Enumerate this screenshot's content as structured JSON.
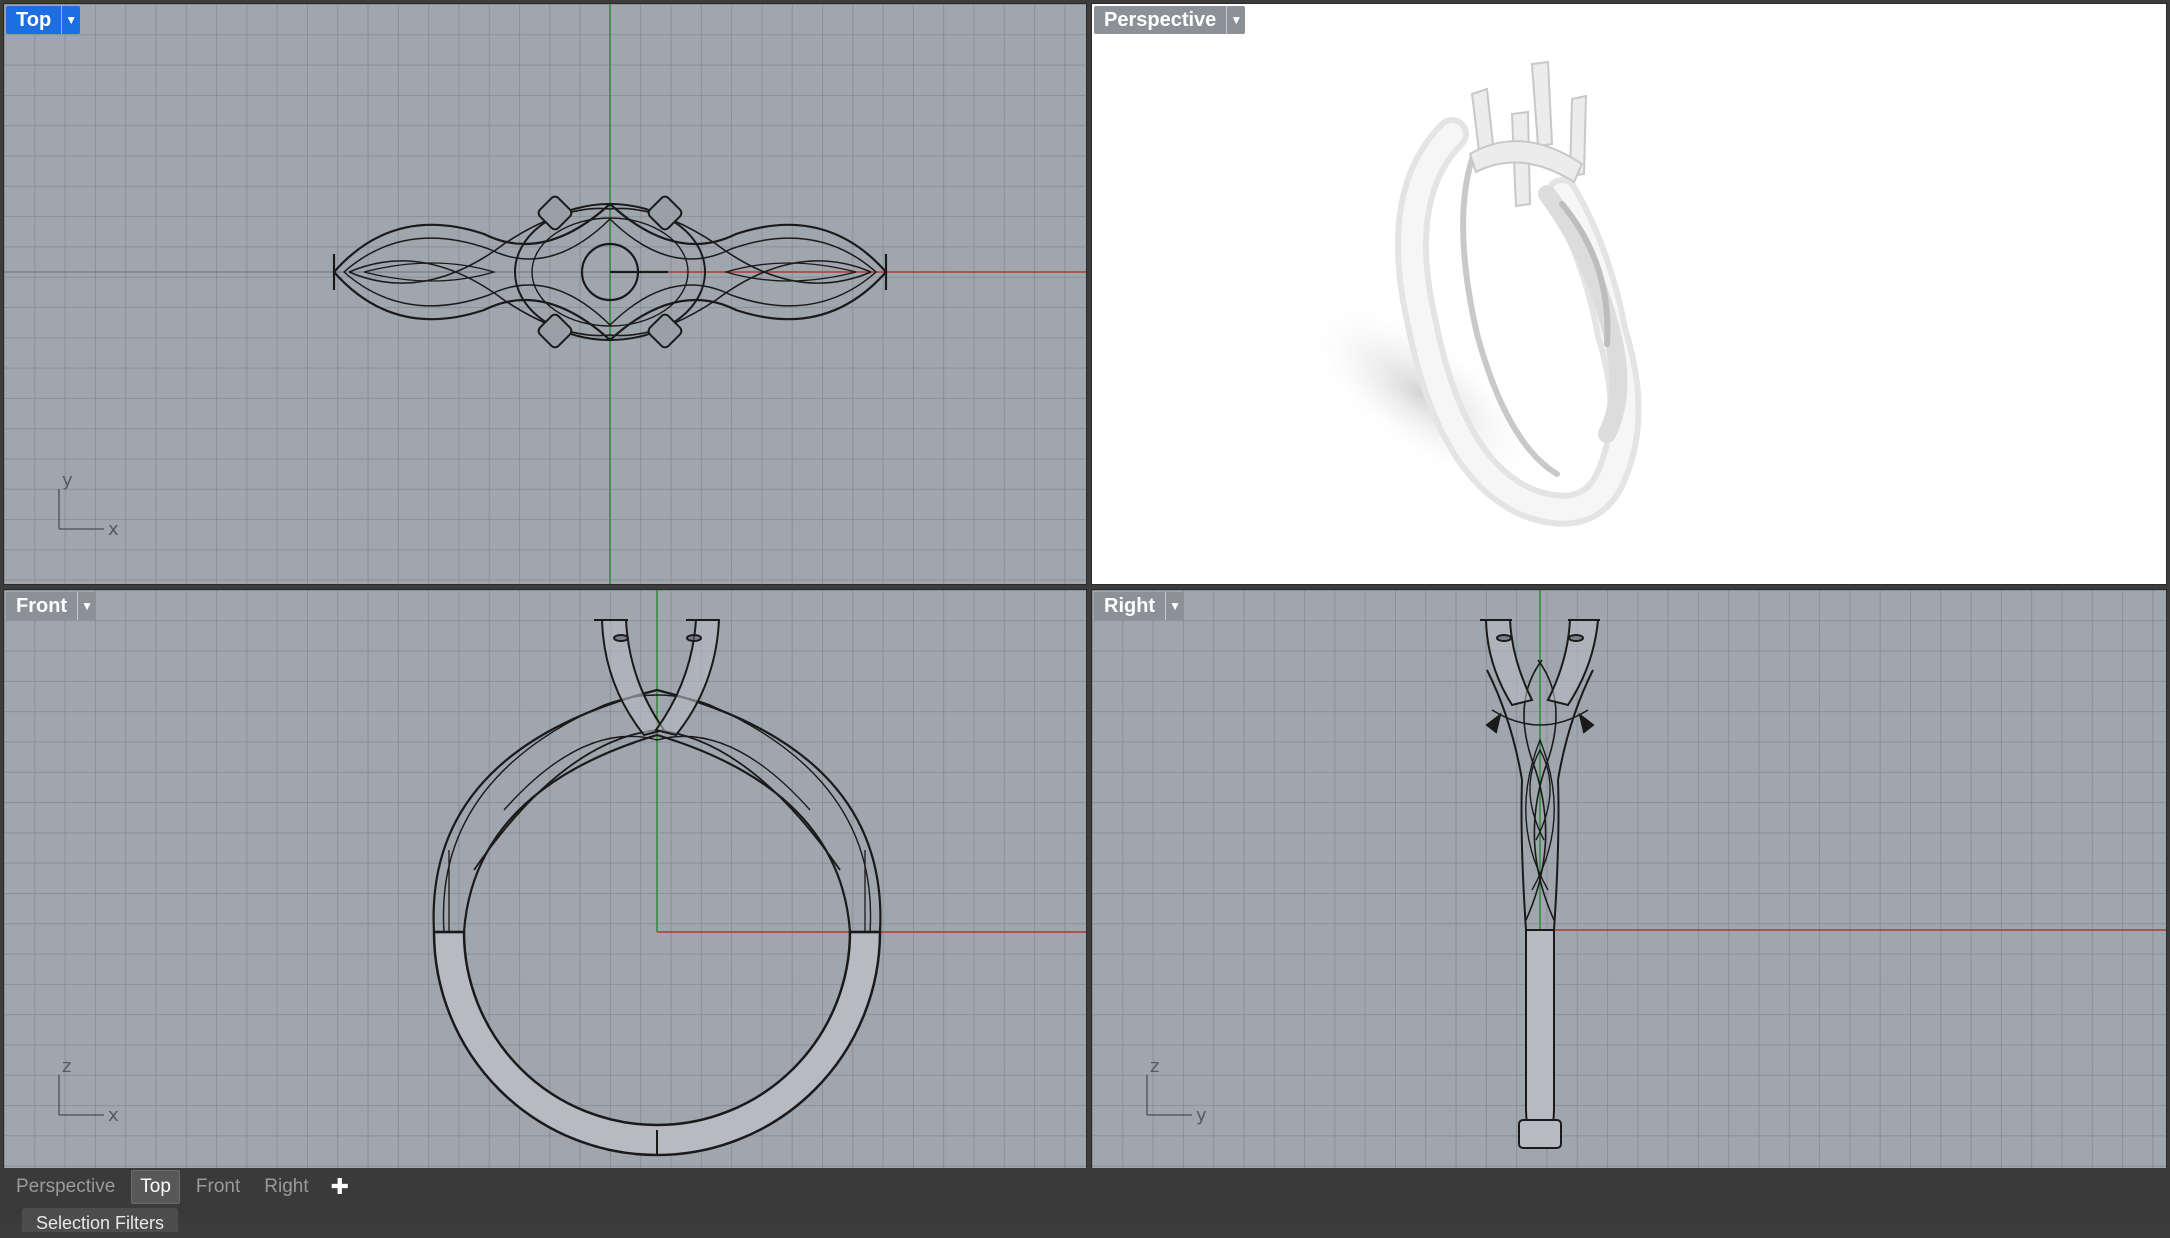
{
  "viewports": {
    "top": {
      "label": "Top",
      "active": true,
      "axis_labels": [
        "y",
        "x"
      ]
    },
    "perspective": {
      "label": "Perspective"
    },
    "front": {
      "label": "Front",
      "axis_labels": [
        "z",
        "x"
      ]
    },
    "right": {
      "label": "Right",
      "axis_labels": [
        "z",
        "y"
      ]
    }
  },
  "bottom_tabs": [
    {
      "label": "Perspective"
    },
    {
      "label": "Top",
      "active": true
    },
    {
      "label": "Front"
    },
    {
      "label": "Right"
    }
  ],
  "add_tab": "✚",
  "selection_filters": "Selection Filters",
  "colors": {
    "accent": "#1b6fe0",
    "viewport_bg": "#a0a6ae",
    "x_axis": "#b03a2e",
    "y_axis": "#2f8a3a"
  },
  "icons": {
    "dropdown": "chevron-down-icon",
    "add": "plus-icon"
  }
}
